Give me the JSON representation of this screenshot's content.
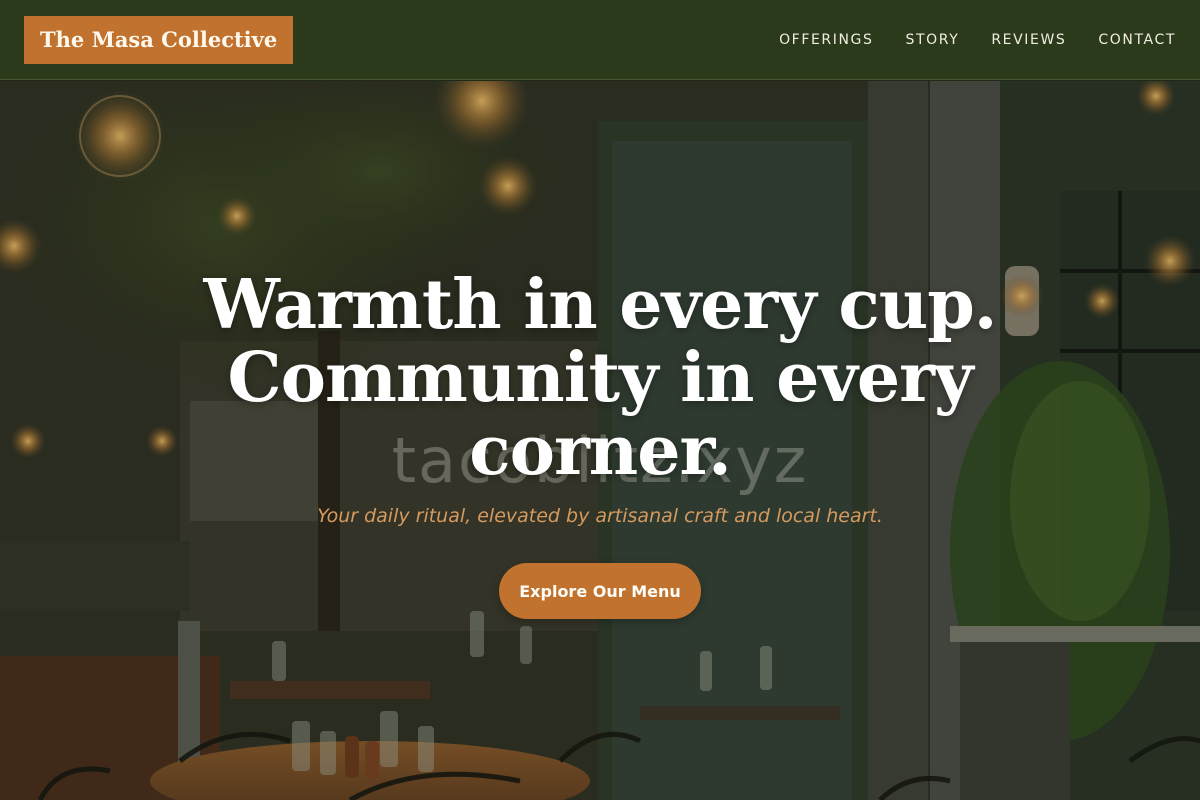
{
  "header": {
    "logo": "The Masa Collective",
    "nav": [
      "OFFERINGS",
      "STORY",
      "REVIEWS",
      "CONTACT"
    ]
  },
  "hero": {
    "headline": [
      "Warmth in every cup.",
      "Community in every",
      "corner."
    ],
    "watermark": "tacoblitz.xyz",
    "tagline": "Your daily ritual, elevated by artisanal craft and local heart.",
    "cta_label": "Explore Our Menu"
  },
  "colors": {
    "header_bg": "#2b3a1b",
    "accent": "#c1722e",
    "tagline": "#d59a5e",
    "headline": "#ffffff"
  }
}
